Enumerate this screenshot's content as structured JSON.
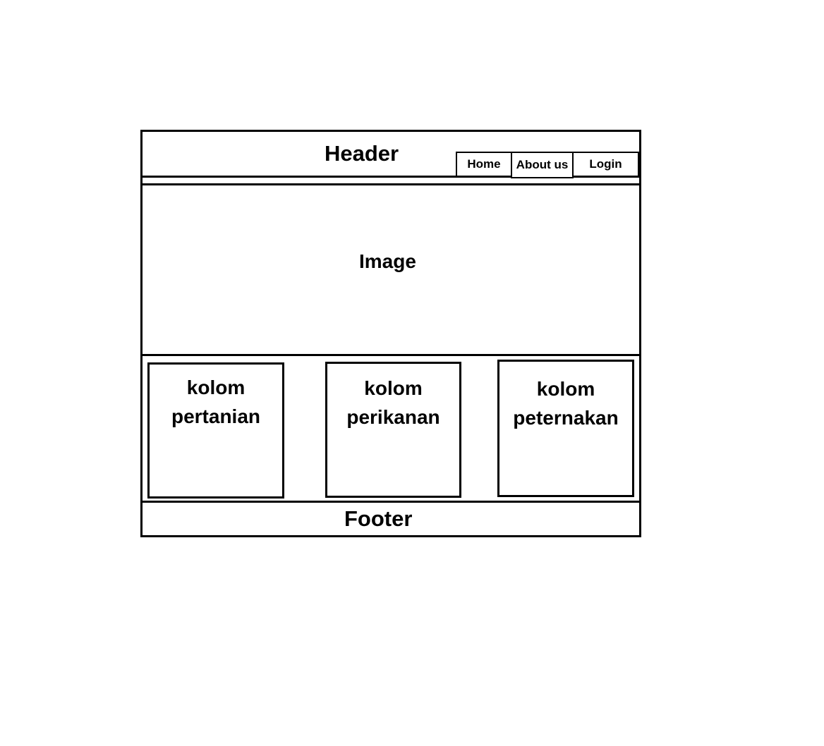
{
  "header": {
    "title": "Header",
    "nav": [
      {
        "label": "Home"
      },
      {
        "label": "About us"
      },
      {
        "label": "Login"
      }
    ]
  },
  "image": {
    "label": "Image"
  },
  "columns": [
    {
      "line1": "kolom",
      "line2": "pertanian"
    },
    {
      "line1": "kolom",
      "line2": "perikanan"
    },
    {
      "line1": "kolom",
      "line2": "peternakan"
    }
  ],
  "footer": {
    "title": "Footer"
  }
}
